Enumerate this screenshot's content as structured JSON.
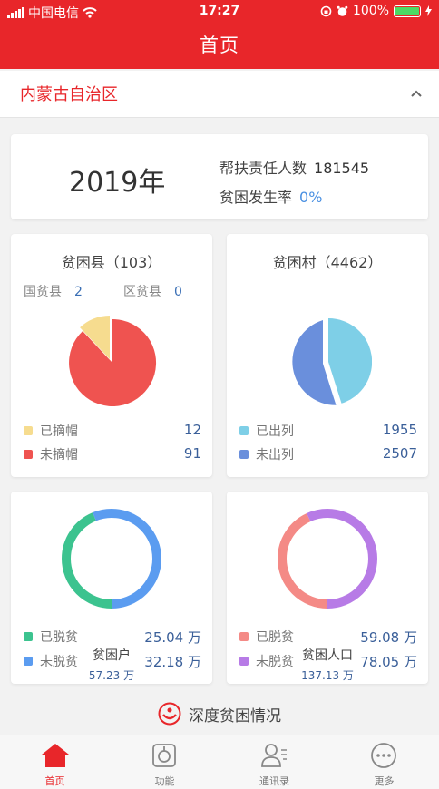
{
  "status_bar": {
    "carrier": "中国电信",
    "time": "17:27",
    "battery": "100%"
  },
  "nav": {
    "title": "首页"
  },
  "region": {
    "name": "内蒙古自治区",
    "toggle_icon": "chevron-up-icon"
  },
  "summary": {
    "year": "2019年",
    "responsible_label": "帮扶责任人数",
    "responsible_value": "181545",
    "rate_label": "贫困发生率",
    "rate_value": "0%"
  },
  "county_card": {
    "title": "贫困县（103）",
    "national_label": "国贫县",
    "national_value": "2",
    "district_label": "区贫县",
    "district_value": "0",
    "legend": [
      {
        "label": "已摘帽",
        "value": "12",
        "color": "#f6dc8f"
      },
      {
        "label": "未摘帽",
        "value": "91",
        "color": "#ef5350"
      }
    ]
  },
  "village_card": {
    "title": "贫困村（4462）",
    "legend": [
      {
        "label": "已出列",
        "value": "1955",
        "color": "#7ecfe7"
      },
      {
        "label": "未出列",
        "value": "2507",
        "color": "#6a8fdc"
      }
    ]
  },
  "household_card": {
    "title": "贫困户",
    "total": "57.23 万",
    "legend": [
      {
        "label": "已脱贫",
        "value": "25.04 万",
        "color": "#3cc38f"
      },
      {
        "label": "未脱贫",
        "value": "32.18 万",
        "color": "#5b9cf0"
      }
    ]
  },
  "population_card": {
    "title": "贫困人口",
    "total": "137.13 万",
    "legend": [
      {
        "label": "已脱贫",
        "value": "59.08 万",
        "color": "#f48a86"
      },
      {
        "label": "未脱贫",
        "value": "78.05 万",
        "color": "#b77be6"
      }
    ]
  },
  "deep_poverty": {
    "label": "深度贫困情况"
  },
  "tabs": [
    {
      "label": "首页",
      "icon": "home-icon",
      "active": true
    },
    {
      "label": "功能",
      "icon": "function-icon",
      "active": false
    },
    {
      "label": "通讯录",
      "icon": "contacts-icon",
      "active": false
    },
    {
      "label": "更多",
      "icon": "more-icon",
      "active": false
    }
  ]
}
